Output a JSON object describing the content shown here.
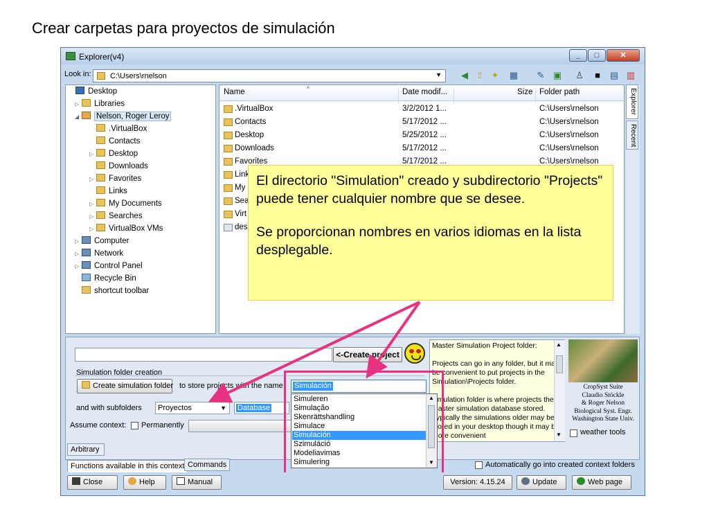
{
  "slide": {
    "title": "Crear carpetas para proyectos de simulación"
  },
  "window": {
    "title": "Explorer(v4)",
    "minimize": "_",
    "maximize": "□",
    "close": "✕"
  },
  "lookin": {
    "label": "Look in:",
    "path": "C:\\Users\\rnelson"
  },
  "tree": [
    {
      "label": "Desktop",
      "icon": "desktop-icon"
    },
    {
      "label": "Libraries",
      "icon": "folder-icon"
    },
    {
      "label": "Nelson, Roger Leroy",
      "icon": "user-folder-icon"
    },
    {
      "label": ".VirtualBox",
      "icon": "folder-icon"
    },
    {
      "label": "Contacts",
      "icon": "folder-icon"
    },
    {
      "label": "Desktop",
      "icon": "folder-icon"
    },
    {
      "label": "Downloads",
      "icon": "folder-icon"
    },
    {
      "label": "Favorites",
      "icon": "folder-icon"
    },
    {
      "label": "Links",
      "icon": "folder-icon"
    },
    {
      "label": "My Documents",
      "icon": "folder-icon"
    },
    {
      "label": "Searches",
      "icon": "folder-icon"
    },
    {
      "label": "VirtualBox VMs",
      "icon": "folder-icon"
    },
    {
      "label": "Computer",
      "icon": "computer-icon"
    },
    {
      "label": "Network",
      "icon": "network-icon"
    },
    {
      "label": "Control Panel",
      "icon": "control-panel-icon"
    },
    {
      "label": "Recycle Bin",
      "icon": "recycle-bin-icon"
    },
    {
      "label": "shortcut toolbar",
      "icon": "folder-icon"
    }
  ],
  "filelist": {
    "columns": {
      "name": "Name",
      "date": "Date modif...",
      "size": "Size",
      "path": "Folder path"
    },
    "rows": [
      {
        "name": ".VirtualBox",
        "date": "3/2/2012 1...",
        "path": "C:\\Users\\rnelson"
      },
      {
        "name": "Contacts",
        "date": "5/17/2012 ...",
        "path": "C:\\Users\\rnelson"
      },
      {
        "name": "Desktop",
        "date": "5/25/2012 ...",
        "path": "C:\\Users\\rnelson"
      },
      {
        "name": "Downloads",
        "date": "5/17/2012 ...",
        "path": "C:\\Users\\rnelson"
      },
      {
        "name": "Favorites",
        "date": "5/17/2012 ...",
        "path": "C:\\Users\\rnelson"
      },
      {
        "name": "Link",
        "date": "",
        "path": ""
      },
      {
        "name": "My",
        "date": "",
        "path": ""
      },
      {
        "name": "Sear",
        "date": "",
        "path": ""
      },
      {
        "name": "Virt",
        "date": "",
        "path": ""
      },
      {
        "name": "des",
        "date": "",
        "path": ""
      }
    ]
  },
  "sidetabs": {
    "explorer": "Explorer",
    "recent": "Recent"
  },
  "callout": {
    "p1": "El directorio \"Simulation\" creado y subdirectorio \"Projects\" puede tener cualquier nombre que se desee.",
    "p2": "Se proporcionan nombres en varios idiomas en la lista desplegable."
  },
  "panel": {
    "create_project": "<-Create project",
    "group_label": "Simulation folder creation",
    "create_folder_btn": "Create simulation folder",
    "store_text": "to store projects with the name",
    "simulation_value": "Simulación",
    "and_with_subfolders": "and  with subfolders",
    "projects_value": "Proyectos",
    "database_value": "Database",
    "assume_context": "Assume context:",
    "permanently": "Permanently",
    "dropdown_options": [
      "Simuleren",
      "Simulação",
      "Skenrättshandling",
      "Simulace",
      "Simulación",
      "Szimuláció",
      "Modeliavimas",
      "Simulering"
    ],
    "dropdown_selected_index": 4,
    "info_p1": "Master Simulation Project folder:",
    "info_p2": "Projects can go in any folder, but it may be convenient to put projects in the Simulation\\Projects folder.",
    "info_p3": "simulation folder is where projects the master simulation database stored.  Typically the simulations older may be stored in your desktop though it may be more convenient",
    "credits": [
      "CropSyst Suite",
      "Claudio Stöckle",
      "& Roger Nelson",
      "Biological Syst. Engr.",
      "Washington State Univ."
    ],
    "weather_tools": "weather tools",
    "auto_go": "Automatically go into created context folders"
  },
  "tabs": {
    "arbitrary": "Arbitrary",
    "functions": "Functions available in this context",
    "commands": "Commands"
  },
  "footer": {
    "close": "Close",
    "help": "Help",
    "manual": "Manual",
    "version": "Version: 4.15.24",
    "update": "Update",
    "webpage": "Web page"
  },
  "colors": {
    "annotation": "#e8327f",
    "callout_bg": "#ffff99",
    "selection": "#3399ff"
  }
}
